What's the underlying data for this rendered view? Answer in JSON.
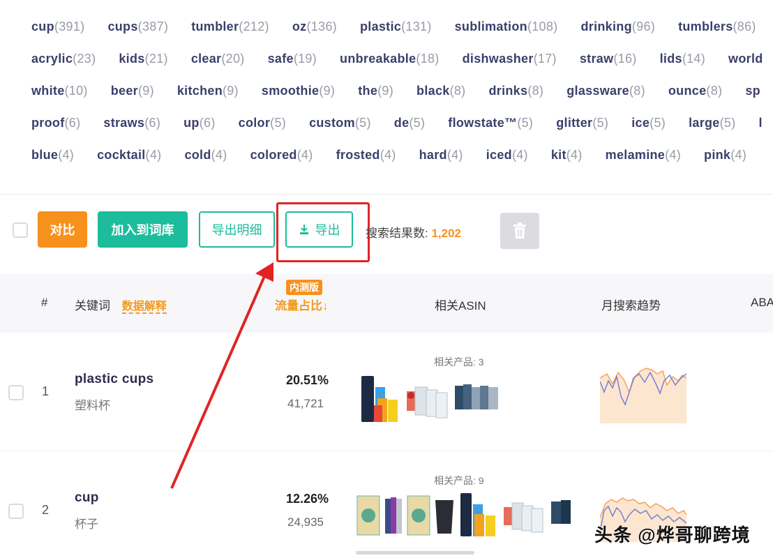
{
  "tags": [
    [
      {
        "word": "cup",
        "count": "(391)"
      },
      {
        "word": "cups",
        "count": "(387)"
      },
      {
        "word": "tumbler",
        "count": "(212)"
      },
      {
        "word": "oz",
        "count": "(136)"
      },
      {
        "word": "plastic",
        "count": "(131)"
      },
      {
        "word": "sublimation",
        "count": "(108)"
      },
      {
        "word": "drinking",
        "count": "(96)"
      },
      {
        "word": "tumblers",
        "count": "(86)"
      }
    ],
    [
      {
        "word": "acrylic",
        "count": "(23)"
      },
      {
        "word": "kids",
        "count": "(21)"
      },
      {
        "word": "clear",
        "count": "(20)"
      },
      {
        "word": "safe",
        "count": "(19)"
      },
      {
        "word": "unbreakable",
        "count": "(18)"
      },
      {
        "word": "dishwasher",
        "count": "(17)"
      },
      {
        "word": "straw",
        "count": "(16)"
      },
      {
        "word": "lids",
        "count": "(14)"
      },
      {
        "word": "world",
        "count": ""
      }
    ],
    [
      {
        "word": "white",
        "count": "(10)"
      },
      {
        "word": "beer",
        "count": "(9)"
      },
      {
        "word": "kitchen",
        "count": "(9)"
      },
      {
        "word": "smoothie",
        "count": "(9)"
      },
      {
        "word": "the",
        "count": "(9)"
      },
      {
        "word": "black",
        "count": "(8)"
      },
      {
        "word": "drinks",
        "count": "(8)"
      },
      {
        "word": "glassware",
        "count": "(8)"
      },
      {
        "word": "ounce",
        "count": "(8)"
      },
      {
        "word": "sp",
        "count": ""
      }
    ],
    [
      {
        "word": "proof",
        "count": "(6)"
      },
      {
        "word": "straws",
        "count": "(6)"
      },
      {
        "word": "up",
        "count": "(6)"
      },
      {
        "word": "color",
        "count": "(5)"
      },
      {
        "word": "custom",
        "count": "(5)"
      },
      {
        "word": "de",
        "count": "(5)"
      },
      {
        "word": "flowstate™",
        "count": "(5)"
      },
      {
        "word": "glitter",
        "count": "(5)"
      },
      {
        "word": "ice",
        "count": "(5)"
      },
      {
        "word": "large",
        "count": "(5)"
      },
      {
        "word": "l",
        "count": ""
      }
    ],
    [
      {
        "word": "blue",
        "count": "(4)"
      },
      {
        "word": "cocktail",
        "count": "(4)"
      },
      {
        "word": "cold",
        "count": "(4)"
      },
      {
        "word": "colored",
        "count": "(4)"
      },
      {
        "word": "frosted",
        "count": "(4)"
      },
      {
        "word": "hard",
        "count": "(4)"
      },
      {
        "word": "iced",
        "count": "(4)"
      },
      {
        "word": "kit",
        "count": "(4)"
      },
      {
        "word": "melamine",
        "count": "(4)"
      },
      {
        "word": "pink",
        "count": "(4)"
      }
    ]
  ],
  "toolbar": {
    "compare_label": "对比",
    "add_to_library_label": "加入到词库",
    "export_detail_label": "导出明细",
    "export_label": "导出",
    "result_label": "搜索结果数:",
    "result_count": "1,202"
  },
  "table": {
    "headers": {
      "num": "#",
      "keyword": "关键词",
      "explain": "数据解释",
      "beta": "内测版",
      "traffic_share": "流量占比↓",
      "related_asin": "相关ASIN",
      "monthly_trend": "月搜索趋势",
      "aba": "ABA"
    },
    "rows": [
      {
        "num": "1",
        "keyword": "plastic cups",
        "keyword_zh": "塑料杯",
        "share": "20.51%",
        "volume": "41,721",
        "related": "相关产品: 3"
      },
      {
        "num": "2",
        "keyword": "cup",
        "keyword_zh": "杯子",
        "share": "12.26%",
        "volume": "24,935",
        "related": "相关产品: 9"
      }
    ]
  },
  "watermark": "头条 @烨哥聊跨境",
  "colors": {
    "orange": "#f7911d",
    "teal": "#1cbc9c",
    "annotation_red": "#e02424",
    "tag_text": "#3a3f6b"
  }
}
